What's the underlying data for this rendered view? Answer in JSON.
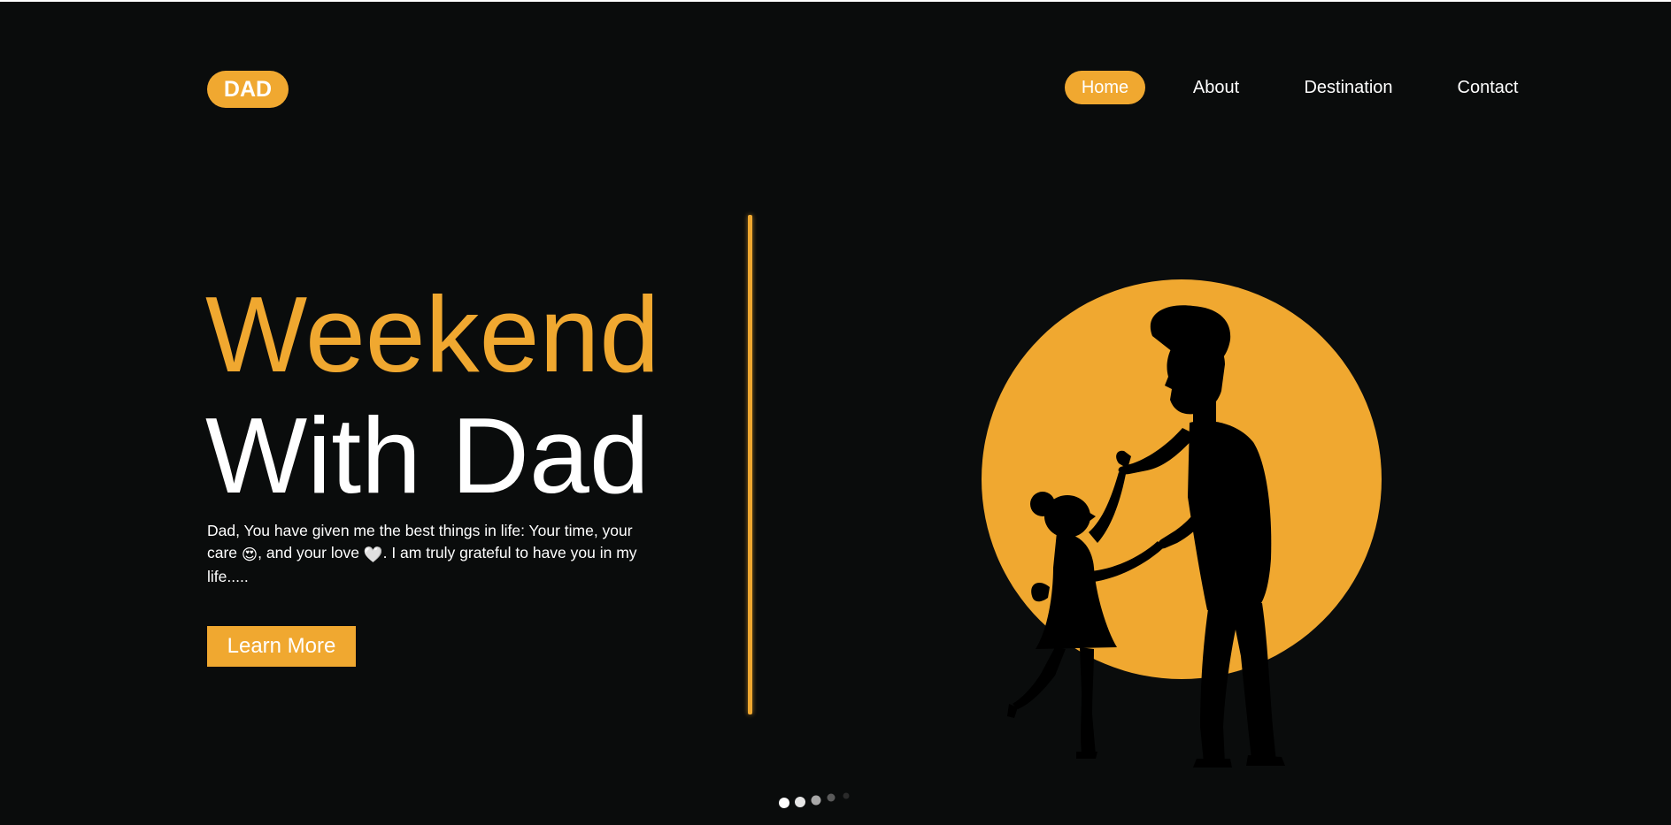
{
  "header": {
    "logo": "DAD",
    "nav": [
      {
        "label": "Home",
        "active": true
      },
      {
        "label": "About",
        "active": false
      },
      {
        "label": "Destination",
        "active": false
      },
      {
        "label": "Contact",
        "active": false
      }
    ]
  },
  "hero": {
    "title_line1": "Weekend",
    "title_line2": "With Dad",
    "description_part1": "Dad, You have given me the best things in life: Your time, your care ",
    "emoji_1": "😍",
    "description_part2": ", and your love ",
    "emoji_2": "🤍",
    "description_part3": ". I am truly grateful to have you in my life.....",
    "cta_label": "Learn More",
    "illustration": "father-daughter-dancing-silhouette"
  },
  "carousel": {
    "slide_count": 5,
    "active_index": 0
  },
  "colors": {
    "background": "#0a0c0c",
    "accent": "#f0a830",
    "text": "#ffffff"
  }
}
